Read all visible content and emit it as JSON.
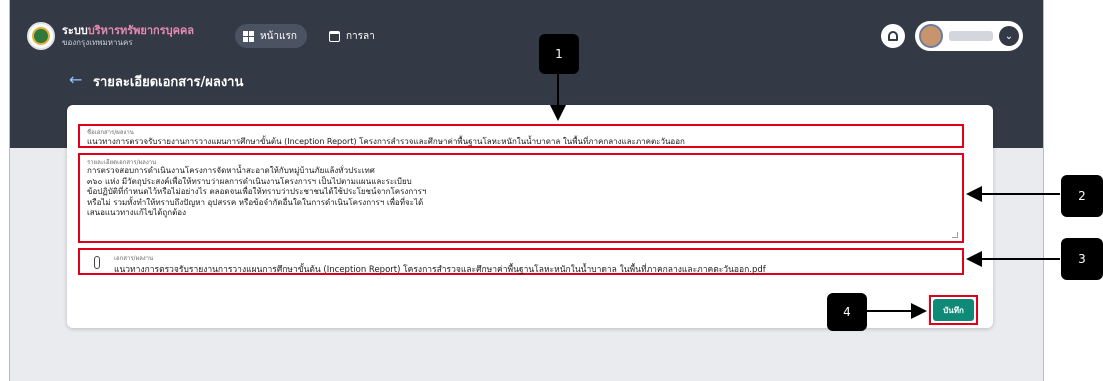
{
  "header": {
    "brand_line1_prefix": "ระบบ",
    "brand_line1_accent": "บริหารทรัพยากรบุคคล",
    "brand_line2": "ของกรุงเทพมหานคร",
    "nav": [
      {
        "label": "หน้าแรก",
        "icon": "grid-icon"
      },
      {
        "label": "การลา",
        "icon": "calendar-icon"
      }
    ],
    "notification_icon": "bell-icon",
    "user_menu_icon": "chevron-down-icon"
  },
  "page": {
    "title": "รายละเอียดเอกสาร/ผลงาน",
    "back_icon": "arrow-left-icon"
  },
  "form": {
    "document_name": {
      "label": "ชื่อเอกสาร/ผลงาน",
      "value": "แนวทางการตรวจรับรายงานการวางแผนการศึกษาขั้นต้น (Inception Report) โครงการสำรวจและศึกษาค่าพื้นฐานโลหะหนักในน้ำบาดาล ในพื้นที่ภาคกลางและภาคตะวันออก"
    },
    "document_detail": {
      "label": "รายละเอียดเอกสาร/ผลงาน",
      "lines": [
        "การตรวจสอบการดำเนินงานโครงการจัดหาน้ำสะอาดให้กับหมู่บ้านภัยแล้งทั่วประเทศ",
        "๓๖๐ แห่ง มีวัตถุประสงค์เพื่อให้ทราบว่าผลการดำเนินงานโครงการฯ เป็นไปตามแผนและระเบียบ",
        "ข้อปฏิบัติที่กำหนดไว้หรือไม่อย่างไร ตลอดจนเพื่อให้ทราบว่าประชาชนได้ใช้ประโยชน์จากโครงการฯ",
        "หรือไม่ รวมทั้งทำให้ทราบถึงปัญหา อุปสรรค หรือข้อจำกัดอื่นใดในการดำเนินโครงการฯ เพื่อที่จะได้",
        "เสนอแนวทางแก้ไขได้ถูกต้อง"
      ]
    },
    "document_file": {
      "label": "เอกสาร/ผลงาน",
      "filename": "แนวทางการตรวจรับรายงานการวางแผนการศึกษาขั้นต้น (Inception Report) โครงการสำรวจและศึกษาค่าพื้นฐานโลหะหนักในน้ำบาดาล ในพื้นที่ภาคกลางและภาคตะวันออก.pdf",
      "icon": "paperclip-icon"
    },
    "save_label": "บันทึก"
  },
  "callouts": [
    "1",
    "2",
    "3",
    "4"
  ],
  "colors": {
    "header_bg": "#333a46",
    "page_bg": "#e9ebef",
    "highlight": "#e0001a",
    "save_button": "#0f8a77",
    "brand_accent": "#e58bb1"
  }
}
